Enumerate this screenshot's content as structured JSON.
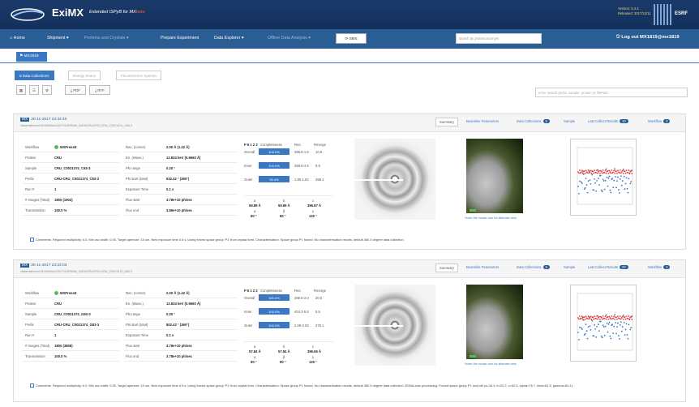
{
  "header": {
    "title": "ExiMX",
    "subtitle": "Extended ISPyB for MX",
    "subtitle_accent": "beta",
    "version": "Version: 5.4.4",
    "released": "Released: 2017/12/11",
    "org": "ESRF"
  },
  "nav": {
    "home": "Home",
    "shipment": "Shipment",
    "proteins": "Proteins and Crystals",
    "prepare": "Prepare Experiment",
    "explorer": "Data Explorer",
    "offline": "Offline Data Analysis",
    "sms": "SMS",
    "search_placeholder": "search by protein acronym",
    "logout": "Log out MX1819@mx1819"
  },
  "proposal": "MX1819",
  "tabs": [
    "8 Data Collections",
    "Energy Scans",
    "Fluorescence Spectra"
  ],
  "toolbar": {
    "pdf": "PDF",
    "rtf": "RTF",
    "filter_placeholder": "enter search prefix, sample, protein or filePath"
  },
  "labels": {
    "workflow": "Workflow",
    "protein": "Protein",
    "sample": "Sample",
    "prefix": "Prefix",
    "run": "Run #",
    "images": "# Images (Total)",
    "transmission": "Transmission",
    "res": "Res. (corner)",
    "en": "En. (Wave.)",
    "phi_range": "Phi range",
    "phi_start": "Phi start (total)",
    "exposure": "Exposure Time",
    "flux_start": "Flux start",
    "flux_end": "Flux end",
    "comments": "Comments",
    "hover": "Hover the mouse over for alternate view",
    "completeness": "Completeness",
    "res_h": "Res.",
    "rmerge": "Rmerge",
    "overall": "Overall",
    "inner": "Inner",
    "outer": "Outer"
  },
  "panel_tabs": [
    "Summary",
    "Beamline Parameters",
    "Data Collections",
    "Sample",
    "Last Collect Results",
    "Workflow"
  ],
  "collections": [
    {
      "date": "30-11-2017 23:42:40",
      "tag": "MX",
      "path": "/data/visitor/mx1819/id30a1/20171130/RAW_DATA/CRU/CRU-CRU_C0021374_C83-3",
      "badges": [
        "5",
        "10",
        "3"
      ],
      "workflow": "MXPressE",
      "protein": "CRU",
      "sample": "CRU_C0021374_C83-3",
      "prefix": "CRU-CRU_C0021374_C83-3",
      "run": "1",
      "images": "1800 (1902)",
      "transmission": "100.0 %",
      "res": "2.00 Å (1.42 Å)",
      "en": "12.834 keV (0.9660 Å)",
      "phi_range": "0.20 °",
      "phi_start": "632.42 ° (360°)",
      "exposure": "0.1 s",
      "flux_start": "3.78e+10 ph/sec",
      "flux_end": "3.86e+10 ph/sec",
      "spacegroup": "P 6 1 2 2",
      "shells": [
        {
          "name": "Overall",
          "comp": "100.0%",
          "res": "398.6-1.8",
          "rmerge": "10.9"
        },
        {
          "name": "Inner",
          "comp": "100.0%",
          "res": "398.6-4.9",
          "rmerge": "5.9"
        },
        {
          "name": "Outer",
          "comp": "99.4%",
          "res": "1.85-1.82",
          "rmerge": "398.1"
        }
      ],
      "cell": {
        "a": "59.89 Å",
        "b": "59.89 Å",
        "c": "396.87 Å",
        "alpha": "90 °",
        "beta": "90 °",
        "gamma": "120 °"
      },
      "comment": "Required multiplicity: 6.0. Min osc width: 0.05. Target aperture: 15 um.      New exposure time 0.5 s.   Using forced space group 'P1' from crystal form. Characterisation: Space group P1 forced. No characterisation results, default 360.0 degree data collection."
    },
    {
      "date": "30-11-2017 23:22:03",
      "tag": "MX",
      "path": "/data/visitor/mx1819/id30a1/20171130/RAW_DATA/CRU/CRU-CRU_C0021374_G83-3",
      "badges": [
        "5",
        "22",
        "3"
      ],
      "workflow": "MXPressE",
      "protein": "CRU",
      "sample": "CRU_C0021374_G83-3",
      "prefix": "CRU-CRU_C0021374_G83-3",
      "run": "1",
      "images": "1800 (3806)",
      "transmission": "100.0 %",
      "res": "2.00 Å (1.42 Å)",
      "en": "12.834 keV (0.9660 Å)",
      "phi_range": "0.20 °",
      "phi_start": "802.42 ° (360°)",
      "exposure": "0.1 s",
      "flux_start": "3.78e+10 ph/sec",
      "flux_end": "3.78e+10 ph/sec",
      "spacegroup": "P 6 1 2 2",
      "shells": [
        {
          "name": "Overall",
          "comp": "100.0%",
          "res": "398.5-2.0",
          "rmerge": "20.5"
        },
        {
          "name": "Inner",
          "comp": "100.0%",
          "res": "404.3-5.5",
          "rmerge": "5.5"
        },
        {
          "name": "Outer",
          "comp": "100.0%",
          "res": "2.09-2.03",
          "rmerge": "279.1"
        }
      ],
      "cell": {
        "a": "57.84 Å",
        "b": "57.84 Å",
        "c": "396.56 Å",
        "alpha": "90 °",
        "beta": "90 °",
        "gamma": "120 °"
      },
      "comment": "Required multiplicity: 6.0. Min osc width: 0.05. Target aperture: 15 um.      New exposure time 0.5 s.   Using forced space group 'P1' from crystal form. Characterisation: Space group P1 forced. No characterisation results, default 360.0 degree data collection.      EDNA auto processing: Forced space group P1 and cell (a=16.3, b=22.2, c=62.5, alpha=76.7, beta=81.5, gamma=80.1)."
    }
  ],
  "colors": {
    "header": "#1b3a6b",
    "nav": "#2a5d94",
    "accent": "#3a78c3",
    "ok": "#5cb85c"
  }
}
